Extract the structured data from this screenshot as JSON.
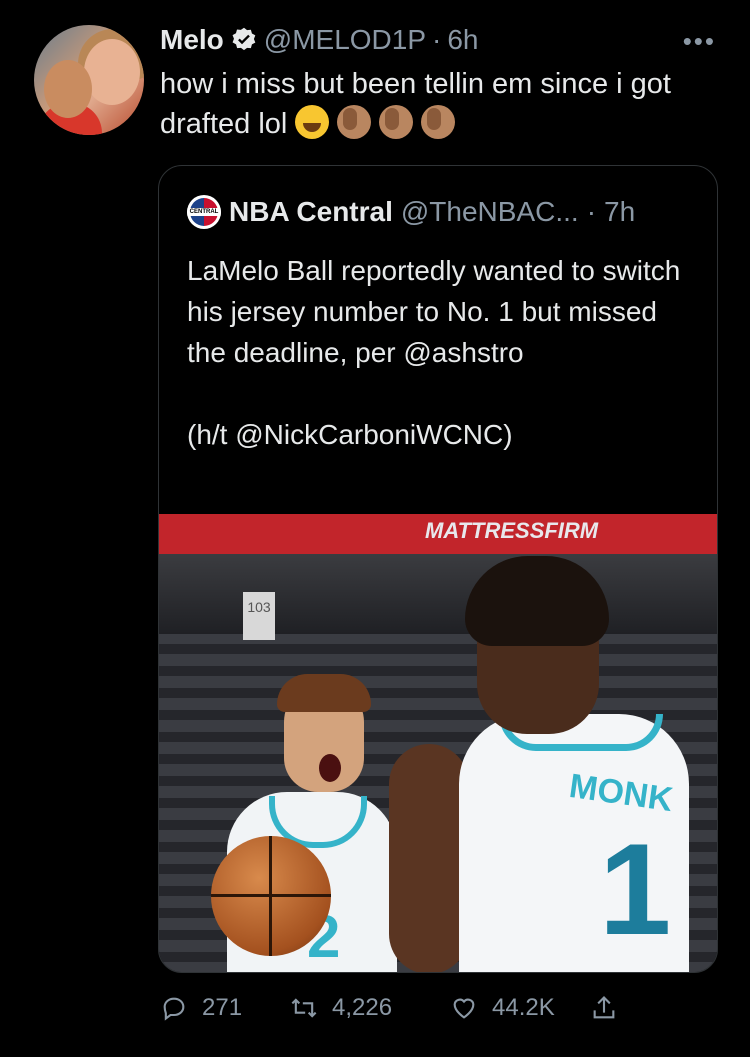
{
  "tweet": {
    "author_name": "Melo",
    "author_handle": "@MELOD1P",
    "separator": "·",
    "time": "6h",
    "more_icon": "more-icon",
    "text": "how i miss but been tellin em since i got drafted lol",
    "emojis": [
      "face-with-tears-of-joy",
      "man-facepalming",
      "man-facepalming",
      "man-facepalming"
    ]
  },
  "quoted": {
    "name": "NBA Central",
    "handle": "@TheNBAC...",
    "separator": "·",
    "time": "7h",
    "logo_text": "CENTRAL",
    "text_lines": [
      "LaMelo Ball reportedly wanted to switch his jersey number to No. 1 but missed the deadline, per @ashstro",
      "(h/t @NickCarboniWCNC)"
    ],
    "photo": {
      "banner_text": "MATTRESSFIRM",
      "sign_text": "103",
      "jersey_name": "MONK",
      "jersey_number_back": "1",
      "jersey_number_front": "2"
    }
  },
  "actions": {
    "reply_count": "271",
    "retweet_count": "4,226",
    "like_count": "44.2K"
  },
  "colors": {
    "background": "#000000",
    "text": "#e7e9ea",
    "secondary": "#8b98a5",
    "border": "#2f3336",
    "verified_badge": "#e7e9ea"
  }
}
